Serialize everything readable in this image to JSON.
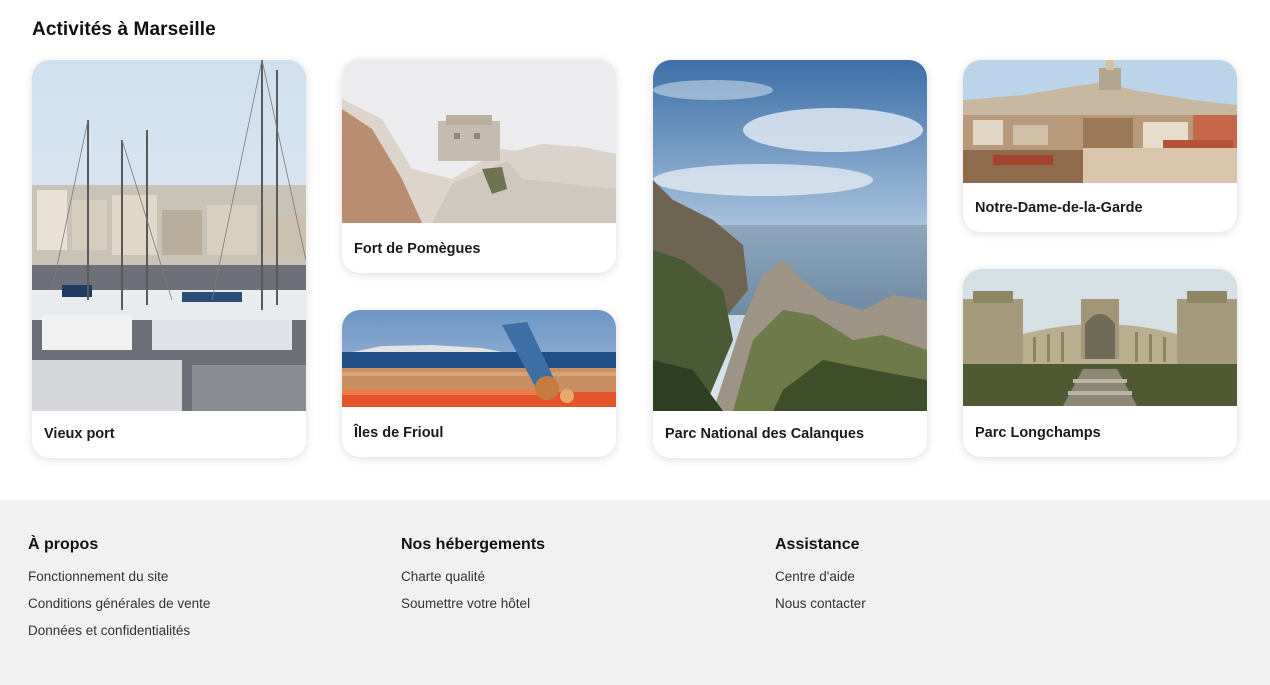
{
  "section": {
    "title": "Activités à Marseille"
  },
  "cards": [
    {
      "label": "Vieux port"
    },
    {
      "label": "Fort de Pomègues"
    },
    {
      "label": "Îles de Frioul"
    },
    {
      "label": "Parc National des Calanques"
    },
    {
      "label": "Notre-Dame-de-la-Garde"
    },
    {
      "label": "Parc Longchamps"
    }
  ],
  "footer": {
    "columns": [
      {
        "title": "À propos",
        "links": [
          "Fonctionnement du site",
          "Conditions générales de vente",
          "Données et confidentialités"
        ]
      },
      {
        "title": "Nos hébergements",
        "links": [
          "Charte qualité",
          "Soumettre votre hôtel"
        ]
      },
      {
        "title": "Assistance",
        "links": [
          "Centre d'aide",
          "Nous contacter"
        ]
      }
    ]
  },
  "colors": {
    "footer_bg": "#f1f1f1",
    "card_bg": "#ffffff",
    "text": "#111111"
  }
}
